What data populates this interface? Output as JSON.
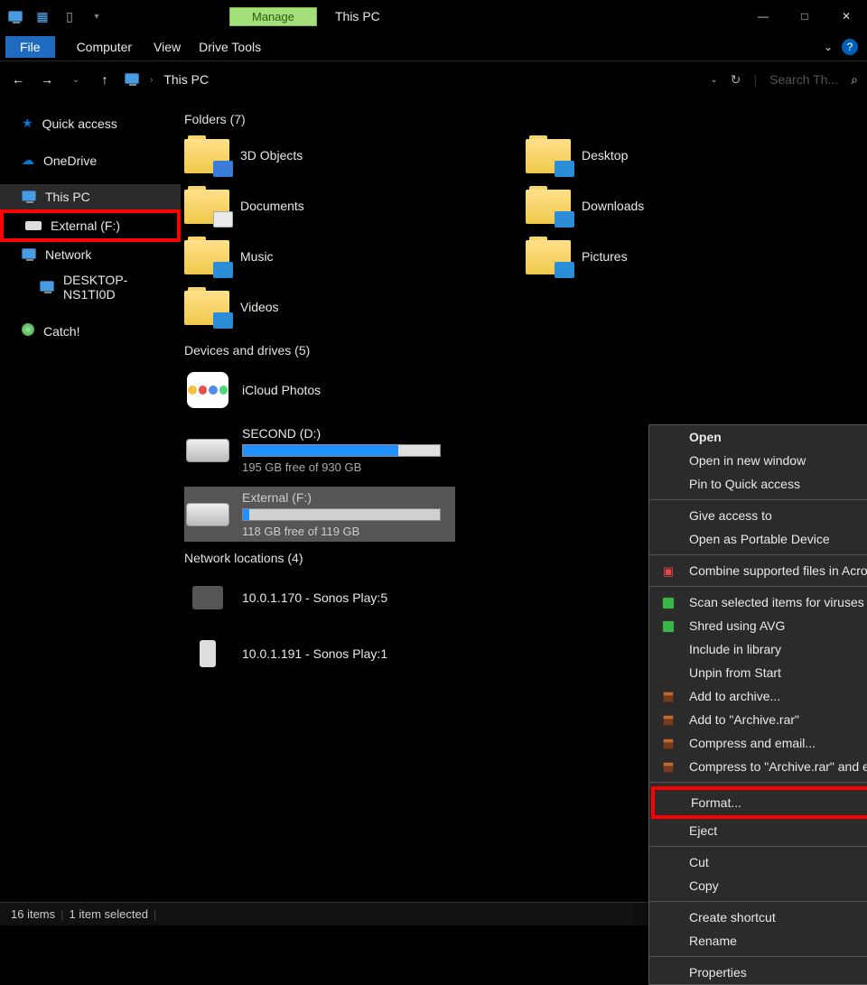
{
  "titlebar": {
    "manage": "Manage",
    "title": "This PC",
    "minimize": "—",
    "maximize": "□",
    "close": "✕"
  },
  "ribbon": {
    "file": "File",
    "computer": "Computer",
    "view": "View",
    "drive_tools": "Drive Tools"
  },
  "address": {
    "breadcrumb": "This PC",
    "search_placeholder": "Search Th...",
    "refresh": "↻"
  },
  "sidebar": {
    "quick_access": "Quick access",
    "onedrive": "OneDrive",
    "this_pc": "This PC",
    "external": "External (F:)",
    "network": "Network",
    "desktop_host": "DESKTOP-NS1TI0D",
    "catch": "Catch!"
  },
  "sections": {
    "folders": "Folders (7)",
    "drives": "Devices and drives (5)",
    "network": "Network locations (4)"
  },
  "folders": {
    "threed": "3D Objects",
    "desktop": "Desktop",
    "documents": "Documents",
    "downloads": "Downloads",
    "music": "Music",
    "pictures": "Pictures",
    "videos": "Videos"
  },
  "drives": {
    "icloud": "iCloud Photos",
    "second_name": "SECOND (D:)",
    "second_free": "195 GB free of 930 GB",
    "second_fill": 79,
    "external_name": "External (F:)",
    "external_free": "118 GB free of 119 GB",
    "external_fill": 3
  },
  "network_items": {
    "sonos5": "10.0.1.170 - Sonos Play:5",
    "sonos1": "10.0.1.191 - Sonos Play:1"
  },
  "context_menu": {
    "open": "Open",
    "open_new": "Open in new window",
    "pin_qa": "Pin to Quick access",
    "give_access": "Give access to",
    "open_portable": "Open as Portable Device",
    "combine_acrobat": "Combine supported files in Acrobat...",
    "scan_virus": "Scan selected items for viruses",
    "shred_avg": "Shred using AVG",
    "include_lib": "Include in library",
    "unpin_start": "Unpin from Start",
    "add_archive": "Add to archive...",
    "add_archive_rar": "Add to \"Archive.rar\"",
    "compress_email": "Compress and email...",
    "compress_rar_email": "Compress to \"Archive.rar\" and email",
    "format": "Format...",
    "eject": "Eject",
    "cut": "Cut",
    "copy": "Copy",
    "create_shortcut": "Create shortcut",
    "rename": "Rename",
    "properties": "Properties"
  },
  "status": {
    "count": "16 items",
    "selected": "1 item selected"
  }
}
